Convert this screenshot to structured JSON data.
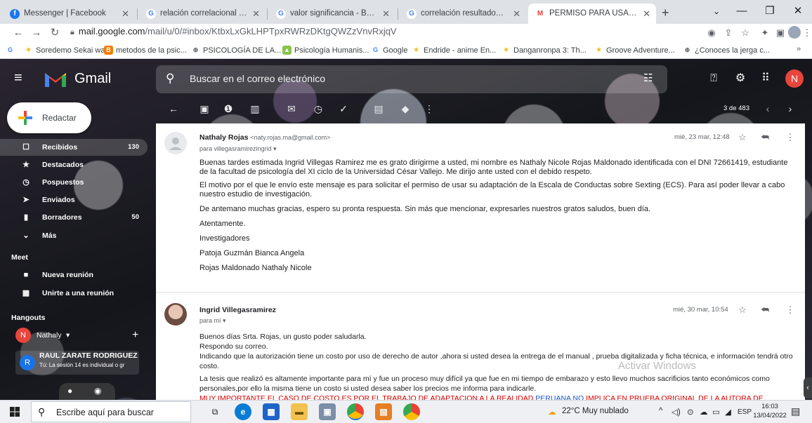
{
  "browser": {
    "tabs": [
      {
        "label": "Messenger | Facebook",
        "fav": "f",
        "fav_color": "#1877f2",
        "active": false
      },
      {
        "label": "relación correlacional entre d",
        "fav": "G",
        "fav_color": "#4285f4",
        "active": false
      },
      {
        "label": "valor significancia - Buscar co",
        "fav": "G",
        "fav_color": "#4285f4",
        "active": false
      },
      {
        "label": "correlación resultados - Busc",
        "fav": "G",
        "fav_color": "#4285f4",
        "active": false
      },
      {
        "label": "PERMISO PARA USAR LA VEI",
        "fav": "M",
        "fav_color": "#ea4335",
        "active": true
      }
    ],
    "new_tab": "+",
    "url_host": "mail.google.com",
    "url_path": "/mail/u/0/#inbox/KtbxLxGkLHPTpxRWRzDKtgQWZzVnvRxjqV",
    "bookmarks": [
      {
        "label": "Soredemo Sekai wa...",
        "icon": "dragon-bookmark-icon",
        "color": "#f5b400"
      },
      {
        "label": "metodos de la psic...",
        "icon": "blogger-bookmark-icon",
        "color": "#f57c00"
      },
      {
        "label": "PSICOLOGÍA DE LA...",
        "icon": "globe-bookmark-icon",
        "color": "#5f6368"
      },
      {
        "label": "Psicología Humanis...",
        "icon": "image-bookmark-icon",
        "color": "#8bc34a"
      },
      {
        "label": "Google",
        "icon": "google-bookmark-icon",
        "color": "#4285f4"
      },
      {
        "label": "Endride - anime En...",
        "icon": "dragon-bookmark-icon",
        "color": "#f5b400"
      },
      {
        "label": "Danganronpa 3: Th...",
        "icon": "dragon-bookmark-icon",
        "color": "#f5b400"
      },
      {
        "label": "Groove Adventure...",
        "icon": "dragon-bookmark-icon",
        "color": "#f5b400"
      },
      {
        "label": "¿Conoces la jerga c...",
        "icon": "globe-bookmark-icon",
        "color": "#5f6368"
      }
    ],
    "bookmarks_more": "»"
  },
  "gmail": {
    "logo_text": "Gmail",
    "search_placeholder": "Buscar en el correo electrónico",
    "avatar_letter": "N",
    "avatar_color": "#e8453c",
    "compose_label": "Redactar",
    "nav": [
      {
        "label": "Recibidos",
        "count": "130",
        "icon": "inbox-icon",
        "glyph": "☐",
        "active": true
      },
      {
        "label": "Destacados",
        "count": "",
        "icon": "star-icon",
        "glyph": "★",
        "active": false
      },
      {
        "label": "Pospuestos",
        "count": "",
        "icon": "clock-icon",
        "glyph": "◷",
        "active": false
      },
      {
        "label": "Enviados",
        "count": "",
        "icon": "send-icon",
        "glyph": "➤",
        "active": false
      },
      {
        "label": "Borradores",
        "count": "50",
        "icon": "draft-icon",
        "glyph": "▮",
        "active": false
      },
      {
        "label": "Más",
        "count": "",
        "icon": "chevron-down-icon",
        "glyph": "⌄",
        "active": false
      }
    ],
    "meet_title": "Meet",
    "meet_items": [
      {
        "label": "Nueva reunión",
        "icon": "video-icon",
        "glyph": "■"
      },
      {
        "label": "Unirte a una reunión",
        "icon": "keyboard-icon",
        "glyph": "▦"
      }
    ],
    "hangouts_title": "Hangouts",
    "hangouts": [
      {
        "name": "Nathaly",
        "suffix": " ▾",
        "letter": "N",
        "color": "#e8453c",
        "sub": ""
      },
      {
        "name": "RAUL ZARATE RODRIGUEZ",
        "suffix": "",
        "letter": "R",
        "color": "#1a73e8",
        "sub": "Tú: La sesión 14 es individual o gr"
      }
    ],
    "pagination": "3 de 483"
  },
  "thread": {
    "messages": [
      {
        "sender": "Nathaly Rojas",
        "email": "<naty.rojas.ma@gmail.com>",
        "to": "para villegasramirezingrid ▾",
        "date": "mié, 23 mar, 12:48",
        "paragraphs": [
          "Buenas tardes estimada Ingrid Villegas Ramirez me es grato dirigirme a usted, mi nombre es Nathaly Nicole Rojas Maldonado identificada con el DNI 72661419, estudiante de la facultad de psicología del XI ciclo de la Universidad César Vallejo. Me dirijo ante usted con el debido respeto.",
          "El motivo por el que le envío este mensaje es para solicitar el permiso  de usar su adaptación de la  Escala de Conductas sobre Sexting (ECS). Para así poder llevar a cabo nuestro estudio de investigación.",
          "De antemano muchas gracias, espero su pronta respuesta. Sin más que mencionar, expresarles nuestros gratos saludos, buen día.",
          "Atentamente.",
          "Investigadores",
          "Patoja Guzmán Bianca Angela",
          "Rojas Maldonado Nathaly Nicole"
        ]
      },
      {
        "sender": "Ingrid Villegasramirez",
        "to": "para mí ▾",
        "date": "mié, 30 mar, 10:54",
        "lines": [
          "Buenos días  Srta. Rojas, un gusto poder saludarla.",
          "Respondo su correo.",
          "Indicando que la autorización tiene un costo por uso de derecho de autor ,ahora si usted desea la entrega de el manual  ,  prueba digitalizada y ficha técnica,  e información tendrá otro costo.",
          "La tesis que realizó es altamente importante para mí y fue un proceso muy difícil ya que fue en mi tiempo de embarazo y esto llevo muchos sacrificios tanto económicos como personales,por ello la misma tiene un costo si usted desea saber los precios me informa para indicarle."
        ],
        "highlight_red_1": "MUY IMPORTANTE EL CASO DE COSTO ES POR EL TRABAJO DE ADAPTACION A LA REALIDAD ",
        "highlight_blue": "PERUANA NO",
        "highlight_red_2": " IMPLICA EN PRUEBA ORIGINAL DE LA AUTORA DE"
      }
    ],
    "watermark": "Activar Windows"
  },
  "taskbar": {
    "search_placeholder": "Escribe aquí para buscar",
    "weather": "22°C  Muy nublado",
    "lang": "ESP",
    "time": "16:03",
    "date": "13/04/2022"
  }
}
